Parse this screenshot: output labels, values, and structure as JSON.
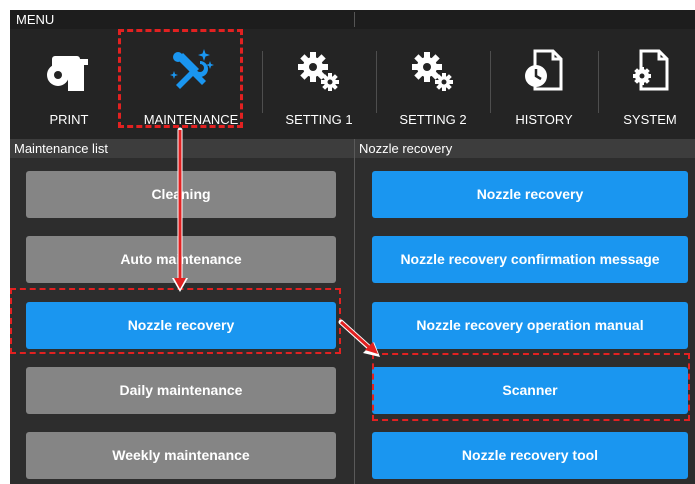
{
  "menu": {
    "title": "MENU"
  },
  "toolbar": {
    "items": [
      {
        "label": "PRINT",
        "icon": "print-icon"
      },
      {
        "label": "MAINTENANCE",
        "icon": "maintenance-icon",
        "active_color": "#1a96f0"
      },
      {
        "label": "SETTING 1",
        "icon": "gears-icon"
      },
      {
        "label": "SETTING 2",
        "icon": "gears-icon"
      },
      {
        "label": "HISTORY",
        "icon": "history-icon"
      },
      {
        "label": "SYSTEM",
        "icon": "system-icon"
      }
    ]
  },
  "maintenance_list": {
    "title": "Maintenance list",
    "items": [
      {
        "label": "Cleaning",
        "selected": false
      },
      {
        "label": "Auto maintenance",
        "selected": false
      },
      {
        "label": "Nozzle recovery",
        "selected": true
      },
      {
        "label": "Daily maintenance",
        "selected": false
      },
      {
        "label": "Weekly maintenance",
        "selected": false
      }
    ]
  },
  "nozzle_recovery": {
    "title": "Nozzle recovery",
    "items": [
      {
        "label": "Nozzle recovery"
      },
      {
        "label": "Nozzle recovery confirmation message"
      },
      {
        "label": "Nozzle recovery operation manual"
      },
      {
        "label": "Scanner"
      },
      {
        "label": "Nozzle recovery tool"
      }
    ]
  },
  "colors": {
    "accent_blue": "#1a96f0",
    "inactive_gray": "#858585",
    "highlight_red": "#e22121",
    "panel_dark": "#2d2d2d"
  }
}
